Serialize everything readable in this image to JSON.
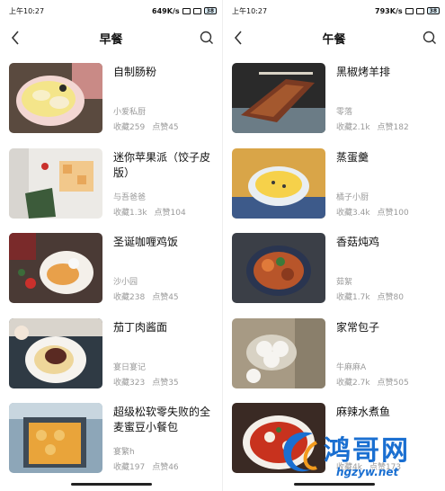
{
  "left": {
    "status": {
      "time": "上午10:27",
      "speed": "649K/s",
      "battery": "38"
    },
    "nav": {
      "title": "早餐"
    },
    "items": [
      {
        "title": "自制肠粉",
        "author": "小爱私厨",
        "favorites": "收藏259",
        "likes": "点赞45"
      },
      {
        "title": "迷你苹果派（饺子皮版）",
        "author": "与吾爸爸",
        "favorites": "收藏1.3k",
        "likes": "点赞104"
      },
      {
        "title": "圣诞咖喱鸡饭",
        "author": "沙小园",
        "favorites": "收藏238",
        "likes": "点赞45"
      },
      {
        "title": "茄丁肉酱面",
        "author": "宴日宴记",
        "favorites": "收藏323",
        "likes": "点赞35"
      },
      {
        "title": "超级松软零失败的全麦蜜豆小餐包",
        "author": "宴繁h",
        "favorites": "收藏197",
        "likes": "点赞46"
      }
    ]
  },
  "right": {
    "status": {
      "time": "上午10:27",
      "speed": "793K/s",
      "battery": "38"
    },
    "nav": {
      "title": "午餐"
    },
    "items": [
      {
        "title": "黑椒烤羊排",
        "author": "零落",
        "favorites": "收藏2.1k",
        "likes": "点赞182"
      },
      {
        "title": "蒸蛋羹",
        "author": "橘子小厨",
        "favorites": "收藏3.4k",
        "likes": "点赞100"
      },
      {
        "title": "香菇炖鸡",
        "author": "茹絮",
        "favorites": "收藏1.7k",
        "likes": "点赞80"
      },
      {
        "title": "家常包子",
        "author": "牛麻麻A",
        "favorites": "收藏2.7k",
        "likes": "点赞505"
      },
      {
        "title": "麻辣水煮鱼",
        "author": "",
        "favorites": "收藏4k",
        "likes": "点赞173"
      }
    ]
  },
  "watermark": {
    "text": "鸿哥网",
    "url": "hgzyw.net"
  },
  "colors": {
    "accent": "#1a6fd1",
    "meta_text": "#9a9a9a"
  }
}
